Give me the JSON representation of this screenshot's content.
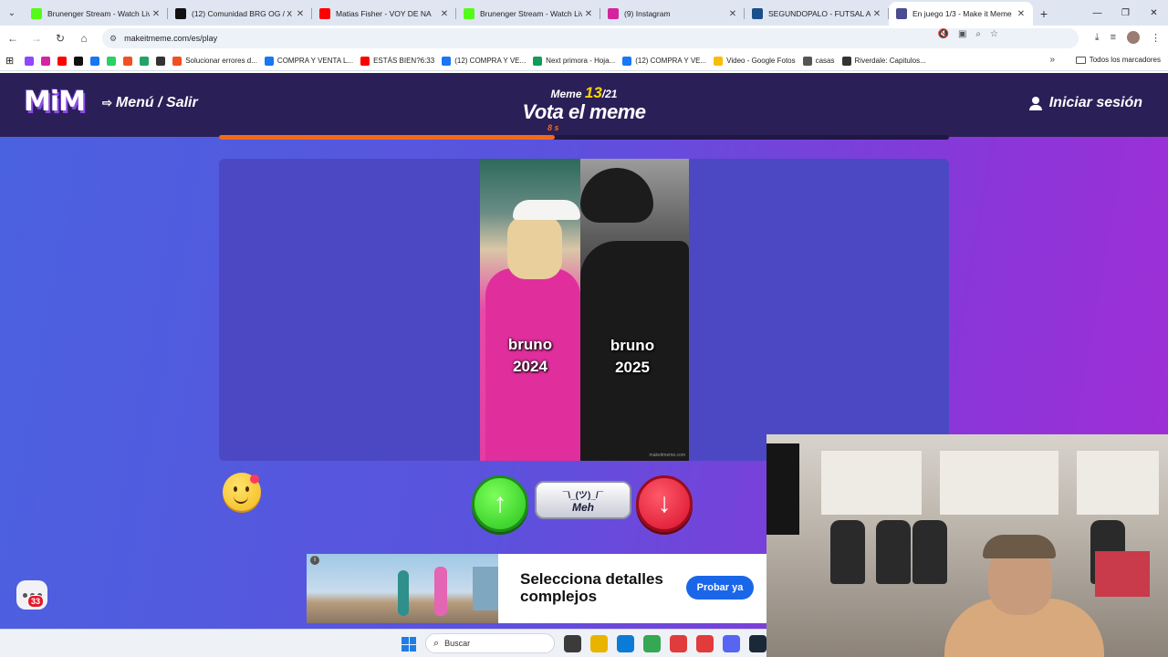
{
  "browser": {
    "tabs": [
      {
        "title": "Brunenger Stream - Watch Live",
        "favicon": "kick-icon",
        "color": "#53fc18",
        "active": false
      },
      {
        "title": "(12) Comunidad BRG OG / X",
        "favicon": "x-icon",
        "color": "#111111",
        "active": false
      },
      {
        "title": "Matias Fisher - VOY DE NA",
        "favicon": "youtube-icon",
        "color": "#ff0000",
        "active": false
      },
      {
        "title": "Brunenger Stream - Watch Live",
        "favicon": "kick-icon",
        "color": "#53fc18",
        "active": false
      },
      {
        "title": "(9) Instagram",
        "favicon": "instagram-icon",
        "color": "#d6249f",
        "active": false
      },
      {
        "title": "SEGUNDOPALO - FUTSAL AFA",
        "favicon": "segundopalo-icon",
        "color": "#1a4f8a",
        "active": false
      },
      {
        "title": "En juego 1/3 - Make it Meme",
        "favicon": "mim-icon",
        "color": "#4b4b8f",
        "active": true
      }
    ],
    "url": "makeitmeme.com/es/play",
    "bookmarks": [
      {
        "label": "",
        "icon": "twitch-icon",
        "color": "#9146ff"
      },
      {
        "label": "",
        "icon": "instagram-icon",
        "color": "#d6249f"
      },
      {
        "label": "",
        "icon": "youtube-icon",
        "color": "#ff0000"
      },
      {
        "label": "",
        "icon": "x-icon",
        "color": "#111111"
      },
      {
        "label": "",
        "icon": "facebook-icon",
        "color": "#1877f2"
      },
      {
        "label": "",
        "icon": "whatsapp-icon",
        "color": "#25d366"
      },
      {
        "label": "",
        "icon": "microsoft-icon",
        "color": "#f25022"
      },
      {
        "label": "",
        "icon": "gamepad-icon",
        "color": "#26a269"
      },
      {
        "label": "",
        "icon": "globe-icon",
        "color": "#333333"
      },
      {
        "label": "Solucionar errores d...",
        "icon": "microsoft-icon",
        "color": "#f25022"
      },
      {
        "label": "COMPRA Y VENTA L...",
        "icon": "facebook-icon",
        "color": "#1877f2"
      },
      {
        "label": "ESTÁS BIEN?6:33",
        "icon": "youtube-icon",
        "color": "#ff0000"
      },
      {
        "label": "(12) COMPRA Y VE...",
        "icon": "facebook-icon",
        "color": "#1877f2"
      },
      {
        "label": "Next primora - Hoja...",
        "icon": "sheets-icon",
        "color": "#0f9d58"
      },
      {
        "label": "(12) COMPRA Y VE...",
        "icon": "facebook-icon",
        "color": "#1877f2"
      },
      {
        "label": "Video - Google Fotos",
        "icon": "photos-icon",
        "color": "#fbbc04"
      },
      {
        "label": "casas",
        "icon": "folder-icon",
        "color": "#555555"
      },
      {
        "label": "Riverdale: Capitulos...",
        "icon": "globe-icon",
        "color": "#333333"
      }
    ],
    "all_bookmarks": "Todos los marcadores"
  },
  "game": {
    "logo": "MiM",
    "menu_exit": "Menú / Salir",
    "meme_word": "Meme",
    "meme_current": "13",
    "meme_total": "/21",
    "title": "Vota el meme",
    "login": "Iniciar sesión",
    "timer_text": "8 s",
    "timer_progress": 0.46,
    "meme_caption_left": "bruno\n2024",
    "meme_caption_right": "bruno\n2025",
    "meme_watermark": "makeitmeme.com",
    "vote_up_icon": "↑",
    "vote_down_icon": "↓",
    "meh_shrug": "¯\\_(ツ)_/¯",
    "meh_label": "Meh",
    "chat_badge": "33"
  },
  "ad": {
    "headline": "Selecciona detalles complejos",
    "cta": "Probar ya"
  },
  "taskbar": {
    "search_placeholder": "Buscar",
    "icons": [
      "#3b3b3b",
      "#e8b400",
      "#0a7bd6",
      "#34a853",
      "#e23b3b",
      "#e23b3b",
      "#5865f2",
      "#1b2838"
    ]
  }
}
